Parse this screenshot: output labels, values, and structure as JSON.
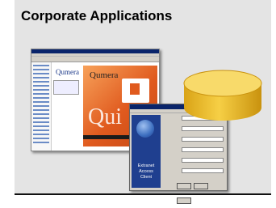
{
  "slide": {
    "title": "Corporate Applications"
  },
  "screenshots": {
    "browser_logo": "Qumera",
    "browser_hero_text": "Qui",
    "dialog_side_text": "Extranet Access Client"
  },
  "colors": {
    "panel": "#e4e4e4",
    "database_fill": "#f3c233",
    "database_top": "#f8da6a",
    "hero_orange": "#e05a1e"
  }
}
